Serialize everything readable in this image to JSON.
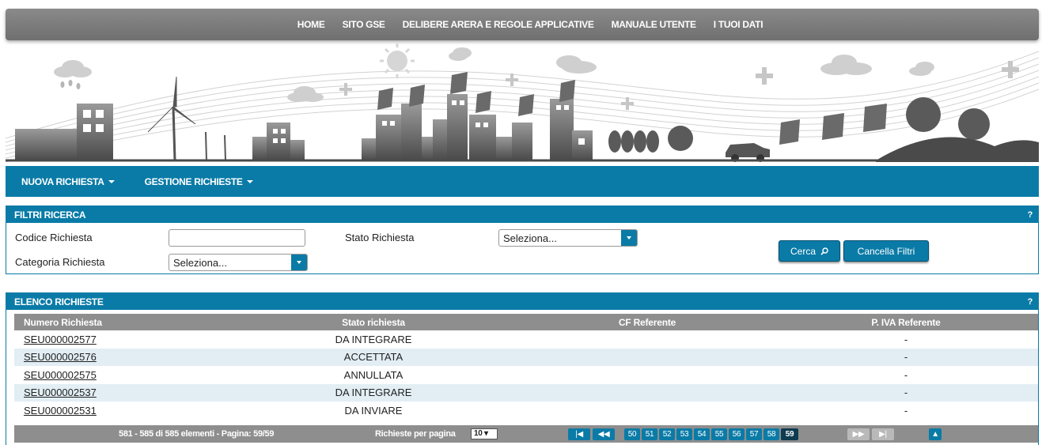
{
  "topnav": {
    "items": [
      "HOME",
      "SITO GSE",
      "DELIBERE ARERA E REGOLE APPLICATIVE",
      "MANUALE UTENTE",
      "I TUOI DATI"
    ]
  },
  "menu": {
    "items": [
      "NUOVA RICHIESTA",
      "GESTIONE RICHIESTE"
    ]
  },
  "filters": {
    "title": "FILTRI RICERCA",
    "help": "?",
    "codice_label": "Codice Richiesta",
    "codice_value": "",
    "stato_label": "Stato Richiesta",
    "stato_value": "Seleziona...",
    "categoria_label": "Categoria Richiesta",
    "categoria_value": "Seleziona...",
    "search_label": "Cerca",
    "clear_label": "Cancella Filtri"
  },
  "list": {
    "title": "ELENCO RICHIESTE",
    "help": "?",
    "columns": [
      "Numero Richiesta",
      "Stato richiesta",
      "CF Referente",
      "P. IVA Referente"
    ],
    "rows": [
      {
        "numero": "SEU000002577",
        "stato": "DA INTEGRARE",
        "cf": "",
        "piva": "-"
      },
      {
        "numero": "SEU000002576",
        "stato": "ACCETTATA",
        "cf": "",
        "piva": "-"
      },
      {
        "numero": "SEU000002575",
        "stato": "ANNULLATA",
        "cf": "",
        "piva": "-"
      },
      {
        "numero": "SEU000002537",
        "stato": "DA INTEGRARE",
        "cf": "",
        "piva": "-"
      },
      {
        "numero": "SEU000002531",
        "stato": "DA INVIARE",
        "cf": "",
        "piva": "-"
      }
    ]
  },
  "pager": {
    "info": "581 - 585 di 585 elementi - Pagina: 59/59",
    "rpp_label": "Richieste per pagina",
    "rpp_value": "10",
    "first": "|◀",
    "prev": "◀◀",
    "pages": [
      "50",
      "51",
      "52",
      "53",
      "54",
      "55",
      "56",
      "57",
      "58",
      "59"
    ],
    "current": "59",
    "next": "▶▶",
    "last": "▶|",
    "top": "▲"
  },
  "colors": {
    "accent": "#0a7ba7",
    "topnav": "#777777",
    "row_alt": "#e2eef4",
    "header": "#8e8e8e"
  }
}
